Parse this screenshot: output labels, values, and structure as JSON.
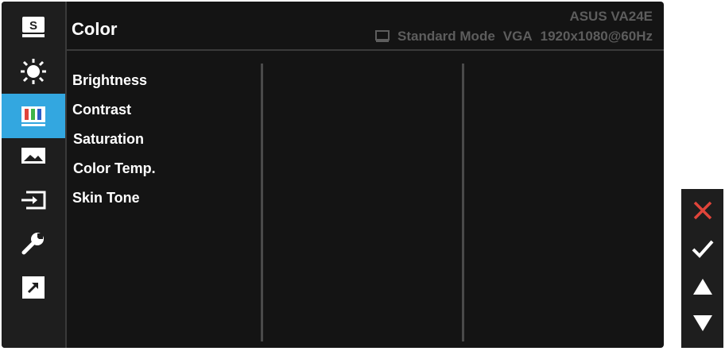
{
  "header": {
    "title": "Color",
    "model": "ASUS  VA24E",
    "mode": "Standard Mode",
    "input": "VGA",
    "resolution": "1920x1080@60Hz"
  },
  "sidebar": {
    "items": [
      {
        "name": "splendid-icon",
        "glyph": "S"
      },
      {
        "name": "brightness-icon"
      },
      {
        "name": "color-icon",
        "active": true
      },
      {
        "name": "image-icon"
      },
      {
        "name": "input-select-icon"
      },
      {
        "name": "system-setup-icon"
      },
      {
        "name": "shortcut-icon"
      }
    ]
  },
  "menu": {
    "items": [
      "Brightness",
      "Contrast",
      "Saturation",
      "Color Temp.",
      "Skin Tone"
    ]
  },
  "nav_buttons": [
    "close-icon",
    "check-icon",
    "up-arrow-icon",
    "down-arrow-icon"
  ],
  "colors": {
    "accent": "#33a7e0",
    "background": "#141414",
    "close": "#e0443a"
  }
}
